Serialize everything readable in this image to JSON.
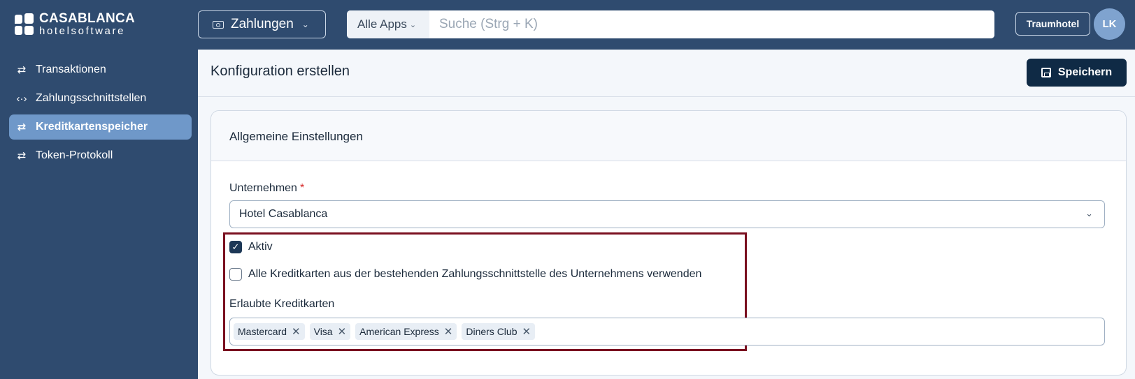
{
  "brand": {
    "line1": "CASABLANCA",
    "line2": "hotelsoftware"
  },
  "app_switcher": {
    "label": "Zahlungen",
    "icon": "cash-icon"
  },
  "search": {
    "scope": "Alle Apps",
    "placeholder": "Suche (Strg + K)",
    "value": ""
  },
  "header": {
    "hotel_button": "Traumhotel",
    "avatar_initials": "LK"
  },
  "sidebar": {
    "items": [
      {
        "label": "Transaktionen",
        "icon": "⇄",
        "active": false
      },
      {
        "label": "Zahlungsschnittstellen",
        "icon": "‹·›",
        "active": false
      },
      {
        "label": "Kreditkartenspeicher",
        "icon": "⇄",
        "active": true
      },
      {
        "label": "Token-Protokoll",
        "icon": "⇄",
        "active": false
      }
    ]
  },
  "page": {
    "title": "Konfiguration erstellen",
    "save_label": "Speichern"
  },
  "card": {
    "title": "Allgemeine Einstellungen",
    "company_label": "Unternehmen",
    "required_mark": "*",
    "company_value": "Hotel Casablanca",
    "active_label": "Aktiv",
    "active_checked": true,
    "use_all_label": "Alle Kreditkarten aus der bestehenden Zahlungsschnittstelle des Unternehmens verwenden",
    "use_all_checked": false,
    "allowed_label": "Erlaubte Kreditkarten",
    "allowed_cards": [
      "Mastercard",
      "Visa",
      "American Express",
      "Diners Club"
    ]
  },
  "colors": {
    "sidebar_bg": "#2f4b6f",
    "active_item": "#6f98c9",
    "primary_button": "#0f2a45",
    "highlight_border": "#7a1020"
  }
}
